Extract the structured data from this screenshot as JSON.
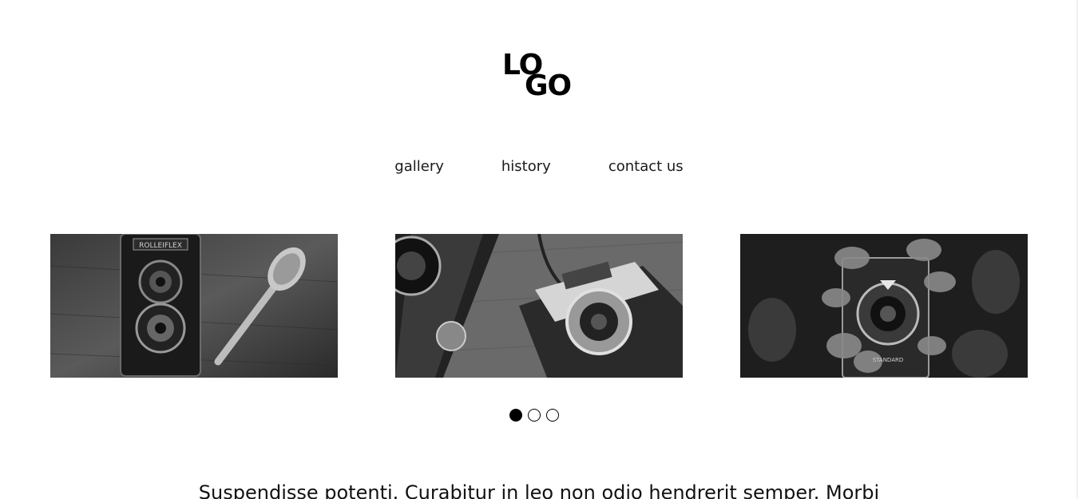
{
  "logo": {
    "line1": "LO",
    "line2": "GO"
  },
  "nav": {
    "items": [
      {
        "label": "gallery"
      },
      {
        "label": "history"
      },
      {
        "label": "contact us"
      }
    ]
  },
  "gallery": {
    "slides": [
      {
        "icon": "rolleiflex-camera-photo"
      },
      {
        "icon": "compact-camera-photo"
      },
      {
        "icon": "agfa-camera-with-leaves-photo"
      }
    ],
    "pagination": {
      "total": 3,
      "active": 1
    }
  },
  "content": {
    "paragraph": "Suspendisse potenti. Curabitur in leo non odio hendrerit semper. Morbi"
  },
  "colors": {
    "background": "#ffffff",
    "text": "#1a1a1a",
    "dot_active": "#000000"
  }
}
